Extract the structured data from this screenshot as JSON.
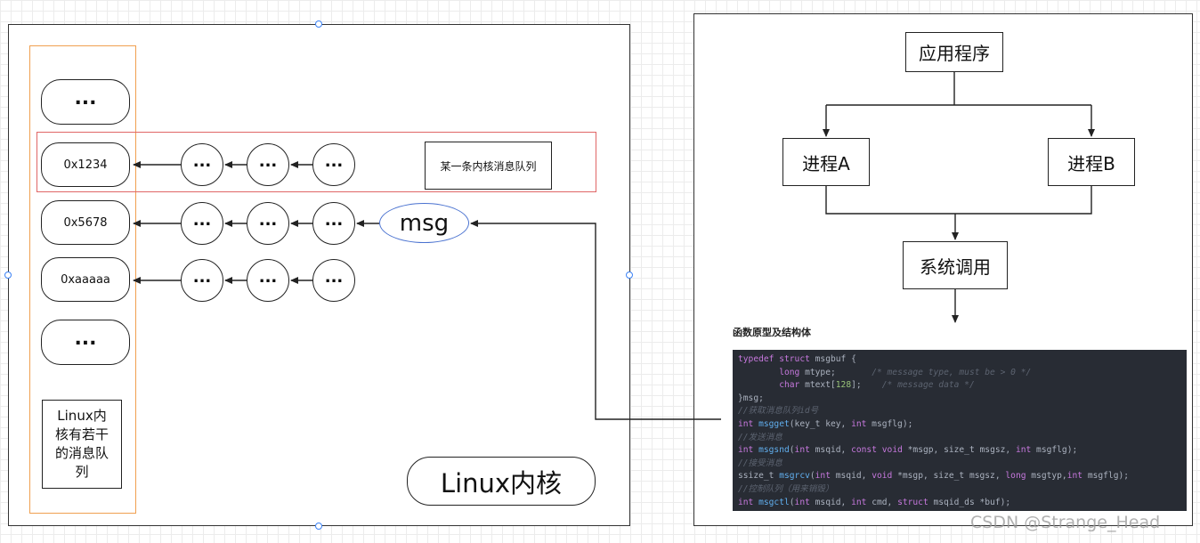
{
  "left_panel": {
    "slots": [
      "...",
      "0x1234",
      "0x5678",
      "0xaaaaa",
      "..."
    ],
    "note": "Linux内\n核有若干\n的消息队\n列",
    "rows": {
      "r1": {
        "dots": [
          "...",
          "...",
          "..."
        ],
        "label": "某一条内核消息队列"
      },
      "r2": {
        "dots": [
          "...",
          "...",
          "..."
        ],
        "msg": "msg"
      },
      "r3": {
        "dots": [
          "...",
          "...",
          "..."
        ]
      }
    },
    "kernel_label": "Linux内核"
  },
  "right_panel": {
    "app": "应用程序",
    "proc_a": "进程A",
    "proc_b": "进程B",
    "syscall": "系统调用",
    "heading": "函数原型及结构体",
    "code": {
      "l1": {
        "k1": "typedef",
        "k2": "struct",
        "t": " msgbuf {"
      },
      "l2": {
        "ind": "        ",
        "k": "long",
        "t": " mtype;",
        "c": "/* message type, must be > 0 */"
      },
      "l3": {
        "ind": "        ",
        "k": "char",
        "t1": " mtext[",
        "n": "128",
        "t2": "];",
        "c": "/* message data */"
      },
      "l4": "}msg;",
      "l5": "//获取消息队列id号",
      "l6": {
        "k": "int",
        "f": "msgget",
        "a": "(key_t key, ",
        "k2": "int",
        "b": " msgflg);"
      },
      "l7": "//发送消息",
      "l8": {
        "k": "int",
        "f": "msgsnd",
        "a": "(",
        "k2": "int",
        "b": " msqid, ",
        "k3": "const",
        "c": " ",
        "k4": "void",
        "d": " *msgp, size_t msgsz, ",
        "k5": "int",
        "e": " msgflg);"
      },
      "l9": "//接受消息",
      "l10": {
        "p": "ssize_t ",
        "f": "msgrcv",
        "a": "(",
        "k": "int",
        "b": " msqid, ",
        "k2": "void",
        "c": " *msgp, size_t msgsz, ",
        "k3": "long",
        "d": " msgtyp,",
        "k4": "int",
        "e": " msgflg);"
      },
      "l11": "//控制队列（用来销毁）",
      "l12": {
        "k": "int",
        "f": "msgctl",
        "a": "(",
        "k2": "int",
        "b": " msqid, ",
        "k3": "int",
        "c": " cmd, ",
        "k4": "struct",
        "d": " msqid_ds *buf);"
      }
    }
  },
  "watermark": "CSDN @Strange_Head"
}
